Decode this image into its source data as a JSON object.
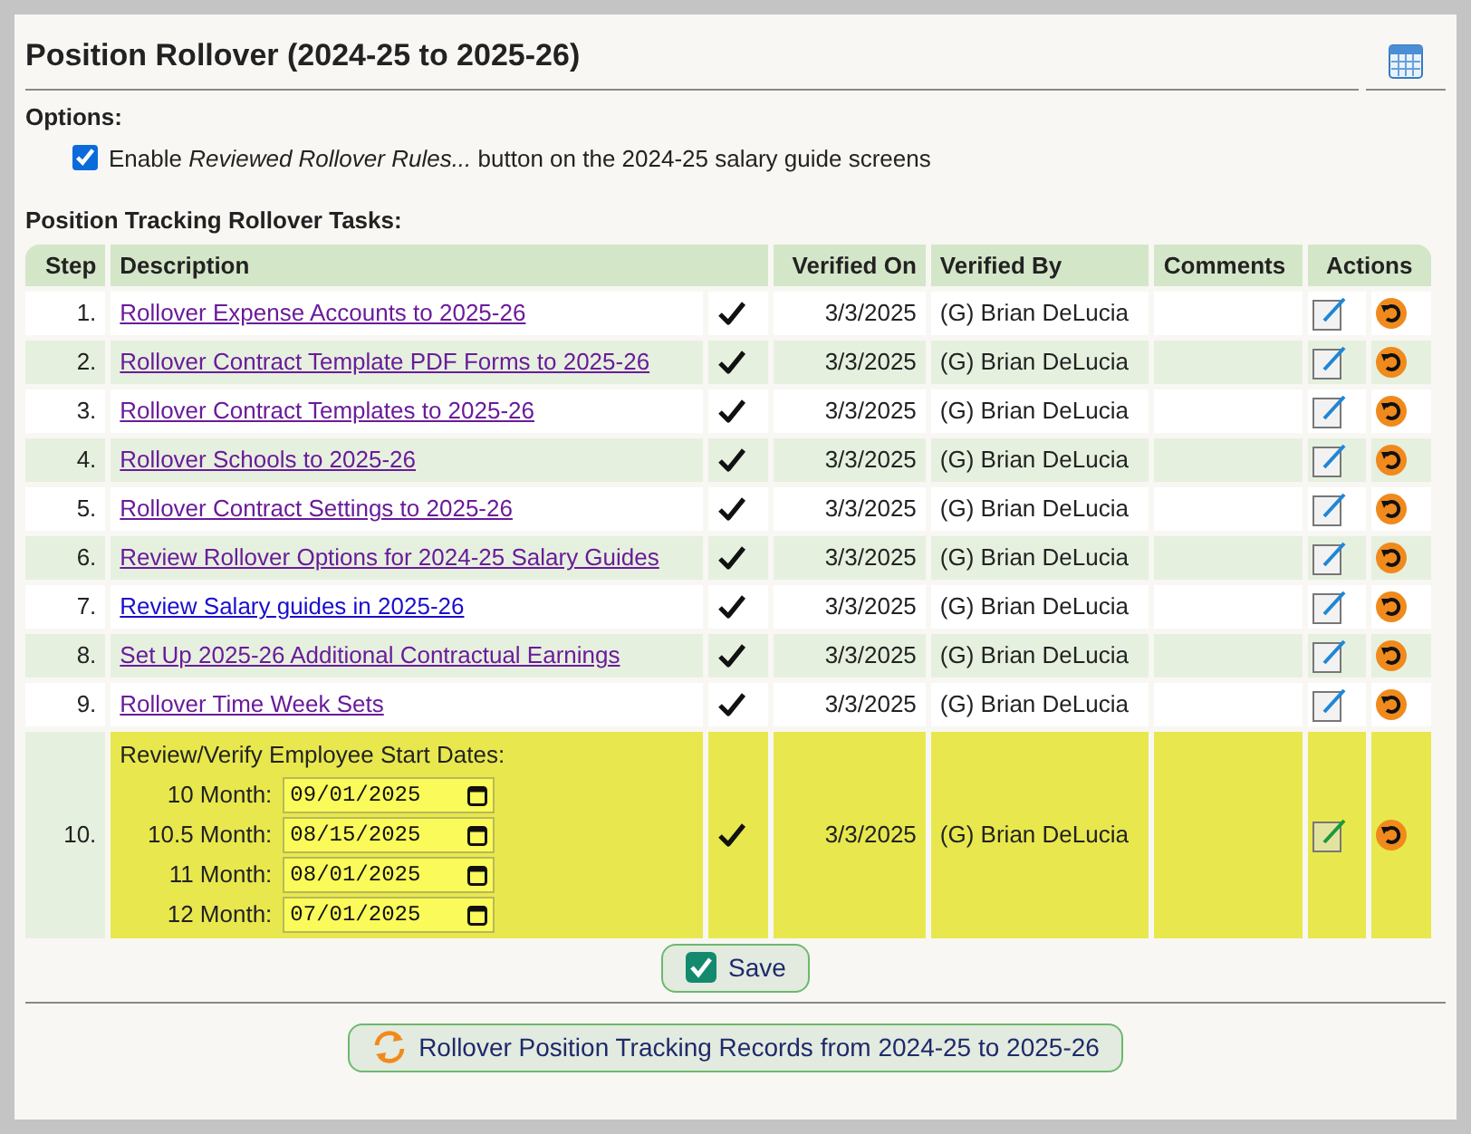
{
  "title": "Position Rollover (2024-25 to 2025-26)",
  "options": {
    "heading": "Options:",
    "checkbox": {
      "checked": true,
      "label": "Enable *Reviewed Rollover Rules...* button on the 2024-25 salary guide screens"
    }
  },
  "tasks_heading": "Position Tracking Rollover Tasks:",
  "table": {
    "columns": [
      "Step",
      "Description",
      "Verified On",
      "Verified By",
      "Comments",
      "Actions"
    ],
    "rows": [
      {
        "kind": "link",
        "step": "1.",
        "description": "Rollover Expense Accounts to 2025-26",
        "visited": true,
        "verified": true,
        "verified_on": "3/3/2025",
        "verified_by": "(G) Brian DeLucia",
        "highlighted": false
      },
      {
        "kind": "link",
        "step": "2.",
        "description": "Rollover Contract Template PDF Forms to 2025-26",
        "visited": true,
        "verified": true,
        "verified_on": "3/3/2025",
        "verified_by": "(G) Brian DeLucia",
        "highlighted": false
      },
      {
        "kind": "link",
        "step": "3.",
        "description": "Rollover Contract Templates to 2025-26",
        "visited": true,
        "verified": true,
        "verified_on": "3/3/2025",
        "verified_by": "(G) Brian DeLucia",
        "highlighted": false
      },
      {
        "kind": "link",
        "step": "4.",
        "description": "Rollover Schools to 2025-26",
        "visited": true,
        "verified": true,
        "verified_on": "3/3/2025",
        "verified_by": "(G) Brian DeLucia",
        "highlighted": false
      },
      {
        "kind": "link",
        "step": "5.",
        "description": "Rollover Contract Settings to 2025-26",
        "visited": true,
        "verified": true,
        "verified_on": "3/3/2025",
        "verified_by": "(G) Brian DeLucia",
        "highlighted": false
      },
      {
        "kind": "link",
        "step": "6.",
        "description": "Review Rollover Options for 2024-25 Salary Guides",
        "visited": true,
        "verified": true,
        "verified_on": "3/3/2025",
        "verified_by": "(G) Brian DeLucia",
        "highlighted": false
      },
      {
        "kind": "link",
        "step": "7.",
        "description": "Review Salary guides in 2025-26",
        "visited": false,
        "verified": true,
        "verified_on": "3/3/2025",
        "verified_by": "(G) Brian DeLucia",
        "highlighted": false
      },
      {
        "kind": "link",
        "step": "8.",
        "description": "Set Up 2025-26 Additional Contractual Earnings",
        "visited": true,
        "verified": true,
        "verified_on": "3/3/2025",
        "verified_by": "(G) Brian DeLucia",
        "highlighted": false
      },
      {
        "kind": "link",
        "step": "9.",
        "description": "Rollover Time Week Sets",
        "visited": true,
        "verified": true,
        "verified_on": "3/3/2025",
        "verified_by": "(G) Brian DeLucia",
        "highlighted": false
      },
      {
        "kind": "dates",
        "step": "10.",
        "description": "Review/Verify Employee Start Dates:",
        "verified": true,
        "verified_on": "3/3/2025",
        "verified_by": "(G) Brian DeLucia",
        "highlighted": true,
        "dates": [
          {
            "label": "10 Month:",
            "value": "09/01/2025"
          },
          {
            "label": "10.5 Month:",
            "value": "08/15/2025"
          },
          {
            "label": "11 Month:",
            "value": "08/01/2025"
          },
          {
            "label": "12 Month:",
            "value": "07/01/2025"
          }
        ]
      }
    ]
  },
  "save_button": "Save",
  "rollover_button": "Rollover Position Tracking Records from 2024-25 to 2025-26"
}
